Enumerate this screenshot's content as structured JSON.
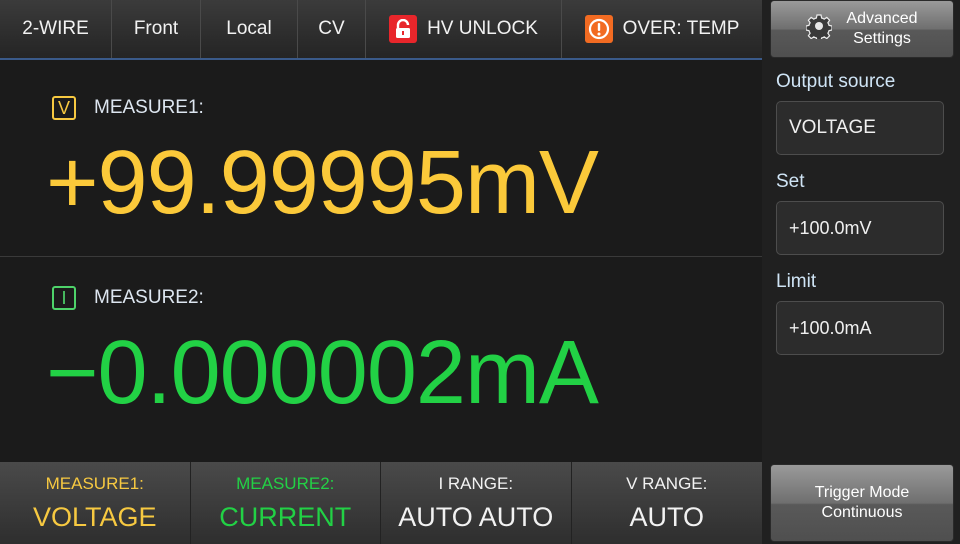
{
  "topbar": {
    "wire": "2-WIRE",
    "terminal": "Front",
    "sense": "Local",
    "mode": "CV",
    "hv_status": "HV UNLOCK",
    "alarm": "OVER: TEMP"
  },
  "measure1": {
    "unit_badge": "V",
    "label": "MEASURE1:",
    "value": "+99.99995mV"
  },
  "measure2": {
    "unit_badge": "I",
    "label": "MEASURE2:",
    "value": "−0.000002mA"
  },
  "bottom": [
    {
      "label": "MEASURE1:",
      "value": "VOLTAGE"
    },
    {
      "label": "MEASURE2:",
      "value": "CURRENT"
    },
    {
      "label": "I RANGE:",
      "value": "AUTO AUTO"
    },
    {
      "label": "V RANGE:",
      "value": "AUTO"
    }
  ],
  "side": {
    "advanced_line1": "Advanced",
    "advanced_line2": "Settings",
    "output_source_label": "Output source",
    "output_source_value": "VOLTAGE",
    "set_label": "Set",
    "set_value": "+100.0mV",
    "limit_label": "Limit",
    "limit_value": "+100.0mA",
    "trigger_line1": "Trigger Mode",
    "trigger_line2": "Continuous"
  },
  "colors": {
    "measure1": "#fbc93a",
    "measure2": "#22d145",
    "lock_icon_bg": "#e8262b",
    "alert_icon_bg": "#f26b22"
  },
  "icons": [
    "lock-icon",
    "alert-icon",
    "gear-icon"
  ]
}
